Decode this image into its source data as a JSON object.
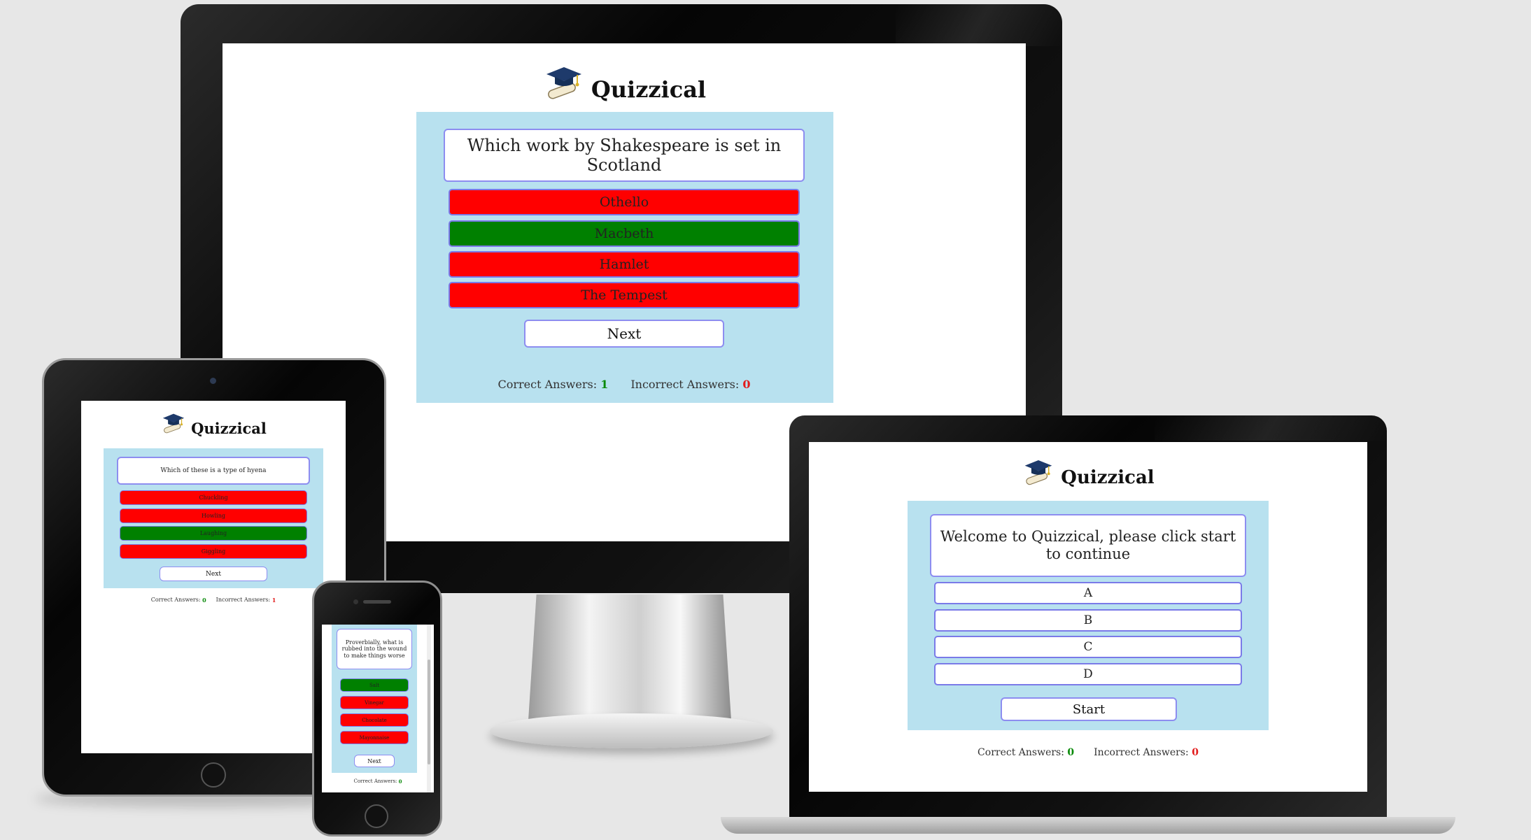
{
  "brand": {
    "name": "Quizzical",
    "logo_icon": "graduation-cap-diploma-icon"
  },
  "colors": {
    "panel": "#b8e1ef",
    "correct": "#008000",
    "incorrect": "#ff0000",
    "border": "#8d8df0"
  },
  "desktop": {
    "question": "Which work by Shakespeare is set in Scotland",
    "answers": [
      {
        "label": "Othello",
        "state": "incorrect"
      },
      {
        "label": "Macbeth",
        "state": "correct"
      },
      {
        "label": "Hamlet",
        "state": "incorrect"
      },
      {
        "label": "The Tempest",
        "state": "incorrect"
      }
    ],
    "button": "Next",
    "score": {
      "correct_label": "Correct Answers:",
      "correct": "1",
      "incorrect_label": "Incorrect Answers:",
      "incorrect": "0"
    }
  },
  "laptop": {
    "question": "Welcome to Quizzical, please click start to continue",
    "answers": [
      {
        "label": "A",
        "state": "neutral"
      },
      {
        "label": "B",
        "state": "neutral"
      },
      {
        "label": "C",
        "state": "neutral"
      },
      {
        "label": "D",
        "state": "neutral"
      }
    ],
    "button": "Start",
    "score": {
      "correct_label": "Correct Answers:",
      "correct": "0",
      "incorrect_label": "Incorrect Answers:",
      "incorrect": "0"
    }
  },
  "tablet": {
    "question": "Which of these is a type of hyena",
    "answers": [
      {
        "label": "Chuckling",
        "state": "incorrect"
      },
      {
        "label": "Howling",
        "state": "incorrect"
      },
      {
        "label": "Laughing",
        "state": "correct"
      },
      {
        "label": "Giggling",
        "state": "incorrect"
      }
    ],
    "button": "Next",
    "score": {
      "correct_label": "Correct Answers:",
      "correct": "0",
      "incorrect_label": "Incorrect Answers:",
      "incorrect": "1"
    }
  },
  "phone": {
    "question": "Proverbially, what is rubbed into the wound to make things worse",
    "answers": [
      {
        "label": "Salt",
        "state": "correct"
      },
      {
        "label": "Vinegar",
        "state": "incorrect"
      },
      {
        "label": "Chocolate",
        "state": "incorrect"
      },
      {
        "label": "Mayonnaise",
        "state": "incorrect"
      }
    ],
    "button": "Next",
    "score": {
      "correct_label": "Correct Answers:",
      "correct": "0"
    }
  }
}
